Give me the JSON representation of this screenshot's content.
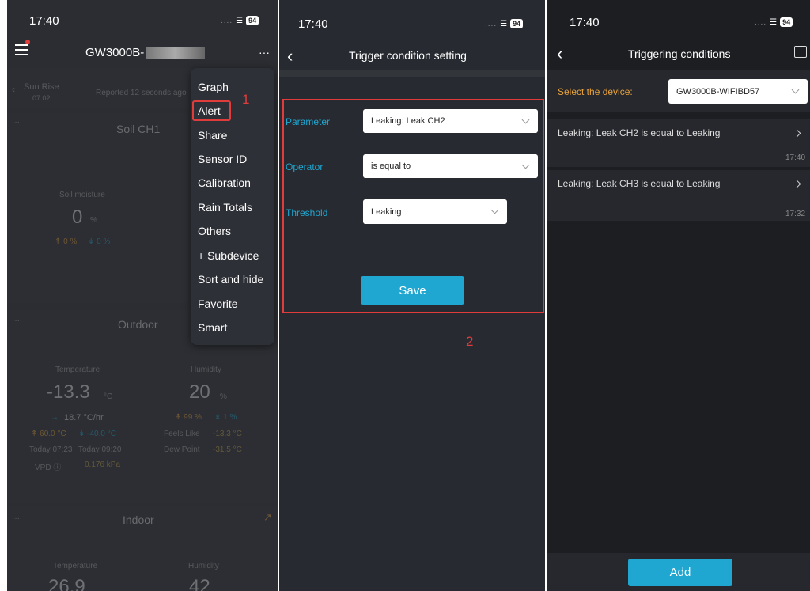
{
  "status": {
    "time": "17:40",
    "signal": "....",
    "battery": "94"
  },
  "p1": {
    "device_title": "GW3000B-",
    "more": "···",
    "sunrise_label": "Sun Rise",
    "sunrise_time": "07:02",
    "reported": "Reported 12 seconds ago",
    "soil": {
      "title": "Soil CH1",
      "dots": "···",
      "moisture_label": "Soil moisture",
      "value": "0",
      "unit": "%",
      "hi": "↟ 0 %",
      "lo": "↡ 0 %"
    },
    "outdoor": {
      "title": "Outdoor",
      "dots": "···",
      "temp_label": "Temperature",
      "temp": "-13.3",
      "temp_unit": "°C",
      "hum_label": "Humidity",
      "hum": "20",
      "hum_unit": "%",
      "rate": "18.7 °C/hr",
      "rate_arrow": "→",
      "hi": "↟ 60.0 °C",
      "lo": "↡ -40.0 °C",
      "hum_hi": "↟ 99 %",
      "hum_lo": "↡ 1 %",
      "hi_time": "Today 07:23",
      "lo_time": "Today 09:20",
      "feels_label": "Feels Like",
      "feels": "-13.3 °C",
      "dew_label": "Dew Point",
      "dew": "-31.5 °C",
      "vpd_label": "VPD ⓘ",
      "vpd": "0.176 kPa"
    },
    "indoor": {
      "title": "Indoor",
      "dots": "···",
      "temp_label": "Temperature",
      "hum_label": "Humidity",
      "temp": "26.9",
      "hum": "42"
    },
    "menu": [
      "Graph",
      "Alert",
      "Share",
      "Sensor ID",
      "Calibration",
      "Rain Totals",
      "Others",
      "+ Subdevice",
      "Sort and hide",
      "Favorite",
      "Smart"
    ],
    "step": "1"
  },
  "p2": {
    "title": "Trigger condition setting",
    "parameter_label": "Parameter",
    "parameter_value": "Leaking: Leak CH2",
    "operator_label": "Operator",
    "operator_value": "is equal to",
    "threshold_label": "Threshold",
    "threshold_value": "Leaking",
    "save": "Save",
    "step": "2"
  },
  "p3": {
    "title": "Triggering conditions",
    "select_label": "Select the device:",
    "device": "GW3000B-WIFIBD57",
    "conditions": [
      {
        "text": "Leaking: Leak CH2 is equal to Leaking",
        "time": "17:40"
      },
      {
        "text": "Leaking: Leak CH3 is equal to Leaking",
        "time": "17:32"
      }
    ],
    "add": "Add"
  },
  "colors": {
    "accent": "#1fa7d2",
    "highlight_box": "#e03c3c",
    "orange": "#e8a23a"
  }
}
